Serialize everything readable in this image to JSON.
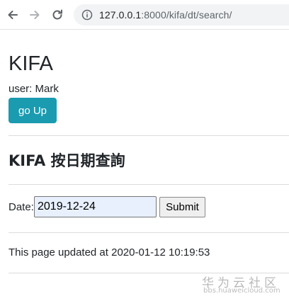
{
  "browser": {
    "url_host": "127.0.0.1",
    "url_rest": ":8000/kifa/dt/search/",
    "icons": {
      "back": "arrow-left-icon",
      "forward": "arrow-right-icon",
      "reload": "reload-icon",
      "info": "info-icon"
    }
  },
  "page": {
    "title": "KIFA",
    "user_line": "user: Mark",
    "go_up_label": "go Up",
    "section_title": "KIFA 按日期查詢",
    "date_label": "Date:",
    "date_value": "2019-12-24",
    "submit_label": "Submit",
    "updated_text": "This page updated at 2020-01-12 10:19:53"
  },
  "watermark": {
    "main": "华为云社区",
    "sub": "bbs.huaweicloud.com"
  },
  "colors": {
    "button_primary": "#1a9bb0",
    "input_autofill": "#e8f0fe"
  }
}
